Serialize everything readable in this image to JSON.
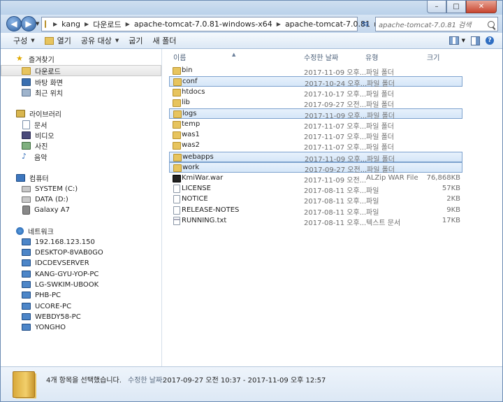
{
  "window": {
    "buttons": {
      "minimize": "–",
      "maximize": "□",
      "close": "✕"
    }
  },
  "address": {
    "crumbs": [
      "kang",
      "다운로드",
      "apache-tomcat-7.0.81-windows-x64",
      "apache-tomcat-7.0.81"
    ],
    "search_placeholder": "apache-tomcat-7.0.81 검색"
  },
  "toolbar": {
    "organize": "구성",
    "open": "열기",
    "share": "공유 대상",
    "burn": "굽기",
    "new_folder": "새 폴더",
    "help": "?"
  },
  "sidebar": {
    "favorites": "즐겨찾기",
    "fav_items": [
      "다운로드",
      "바탕 화면",
      "최근 위치"
    ],
    "libraries": "라이브러리",
    "lib_items": [
      "문서",
      "비디오",
      "사진",
      "음악"
    ],
    "computer": "컴퓨터",
    "comp_items": [
      "SYSTEM (C:)",
      "DATA (D:)",
      "Galaxy A7"
    ],
    "network": "네트워크",
    "net_items": [
      "192.168.123.150",
      "DESKTOP-8VAB0GO",
      "IDCDEVSERVER",
      "KANG-GYU-YOP-PC",
      "LG-SWKIM-UBOOK",
      "PHB-PC",
      "UCORE-PC",
      "WEBDY58-PC",
      "YONGHO"
    ]
  },
  "columns": {
    "name": "이름",
    "date": "수정한 날짜",
    "type": "유형",
    "size": "크기"
  },
  "files": [
    {
      "name": "bin",
      "date": "2017-11-09 오후...",
      "type": "파일 폴더",
      "size": "",
      "kind": "folder",
      "selected": false
    },
    {
      "name": "conf",
      "date": "2017-10-24 오후...",
      "type": "파일 폴더",
      "size": "",
      "kind": "folder",
      "selected": true
    },
    {
      "name": "htdocs",
      "date": "2017-10-17 오후...",
      "type": "파일 폴더",
      "size": "",
      "kind": "folder",
      "selected": false
    },
    {
      "name": "lib",
      "date": "2017-09-27 오전...",
      "type": "파일 폴더",
      "size": "",
      "kind": "folder",
      "selected": false
    },
    {
      "name": "logs",
      "date": "2017-11-09 오후...",
      "type": "파일 폴더",
      "size": "",
      "kind": "folder",
      "selected": true
    },
    {
      "name": "temp",
      "date": "2017-11-07 오후...",
      "type": "파일 폴더",
      "size": "",
      "kind": "folder",
      "selected": false
    },
    {
      "name": "was1",
      "date": "2017-11-07 오후...",
      "type": "파일 폴더",
      "size": "",
      "kind": "folder",
      "selected": false
    },
    {
      "name": "was2",
      "date": "2017-11-07 오후...",
      "type": "파일 폴더",
      "size": "",
      "kind": "folder",
      "selected": false
    },
    {
      "name": "webapps",
      "date": "2017-11-09 오후...",
      "type": "파일 폴더",
      "size": "",
      "kind": "folder",
      "selected": true
    },
    {
      "name": "work",
      "date": "2017-09-27 오전...",
      "type": "파일 폴더",
      "size": "",
      "kind": "folder",
      "selected": true
    },
    {
      "name": "KmiWar.war",
      "date": "2017-11-09 오전...",
      "type": "ALZip WAR File",
      "size": "76,868KB",
      "kind": "war",
      "selected": false
    },
    {
      "name": "LICENSE",
      "date": "2017-08-11 오후...",
      "type": "파일",
      "size": "57KB",
      "kind": "file",
      "selected": false
    },
    {
      "name": "NOTICE",
      "date": "2017-08-11 오후...",
      "type": "파일",
      "size": "2KB",
      "kind": "file",
      "selected": false
    },
    {
      "name": "RELEASE-NOTES",
      "date": "2017-08-11 오후...",
      "type": "파일",
      "size": "9KB",
      "kind": "file",
      "selected": false
    },
    {
      "name": "RUNNING.txt",
      "date": "2017-08-11 오후...",
      "type": "텍스트 문서",
      "size": "17KB",
      "kind": "txt",
      "selected": false
    }
  ],
  "details": {
    "count_text": "4개 항목을 선택했습니다.",
    "date_label": "수정한 날짜:",
    "date_range": "2017-09-27 오전 10:37 - 2017-11-09 오후 12:57"
  }
}
